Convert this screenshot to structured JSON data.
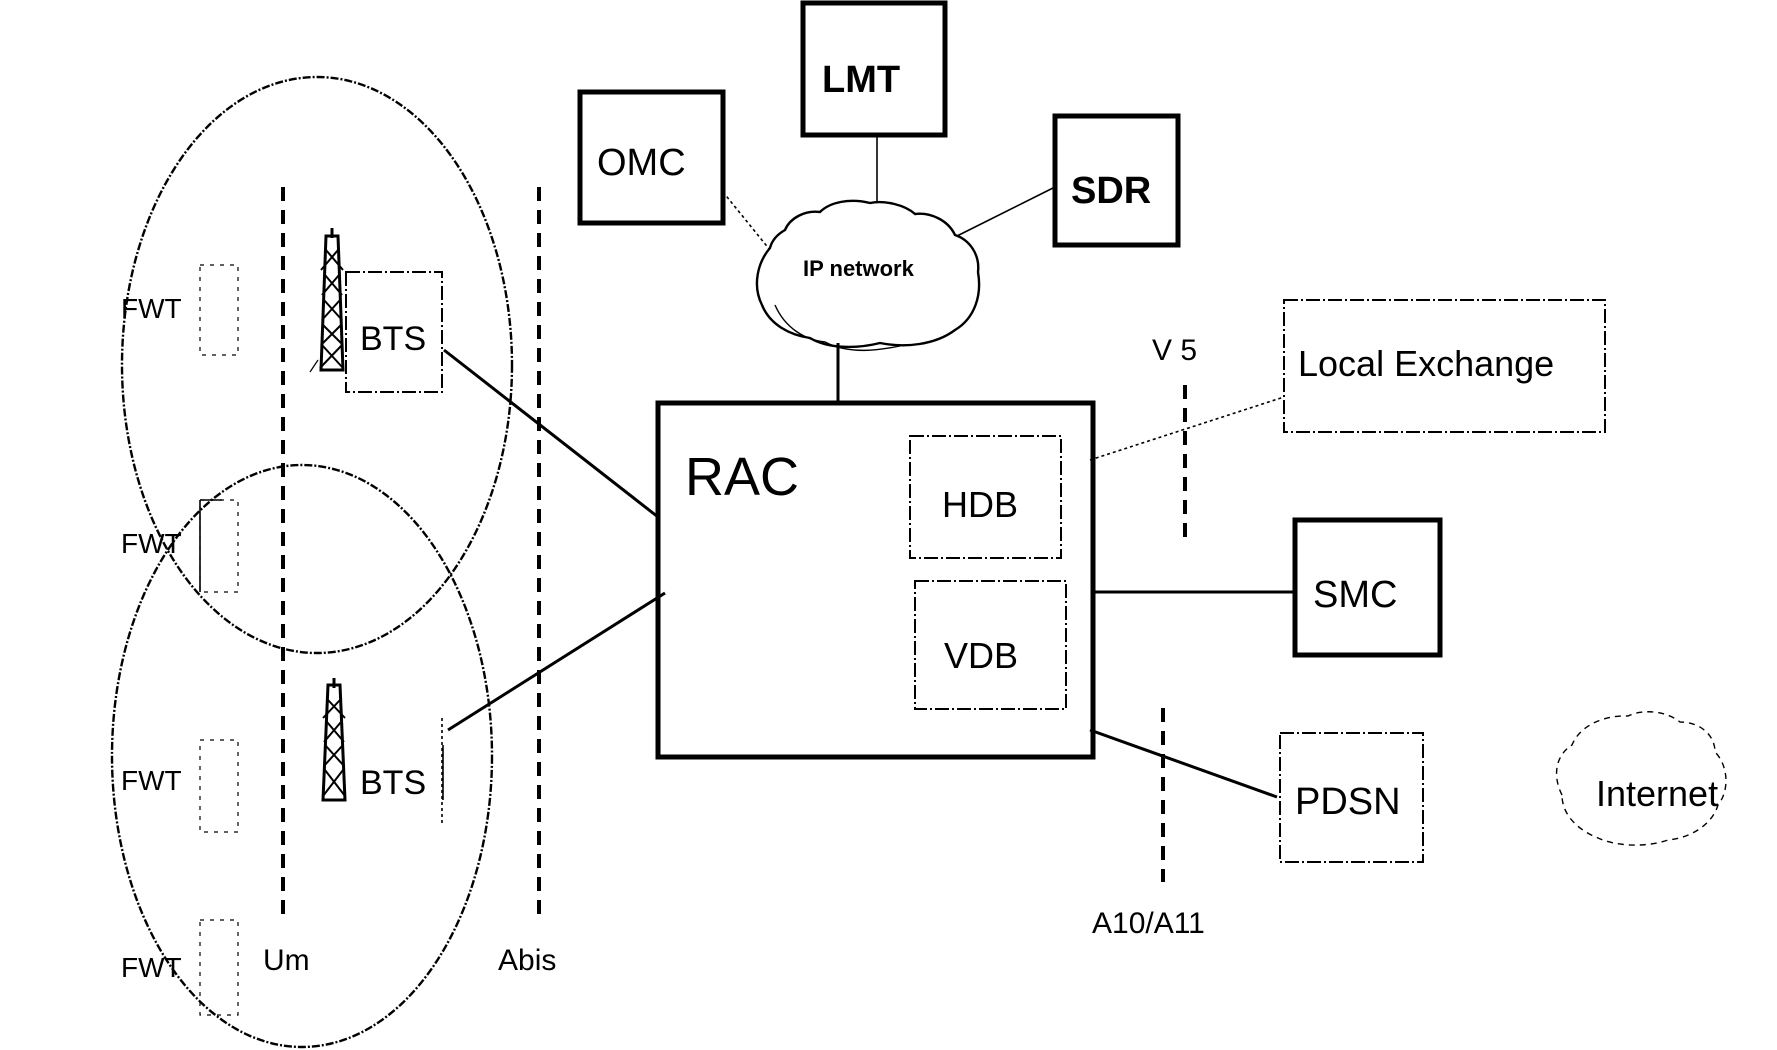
{
  "diagram": {
    "nodes": {
      "omc": "OMC",
      "lmt": "LMT",
      "sdr": "SDR",
      "ip_network": "IP network",
      "local_exchange": "Local Exchange",
      "rac": "RAC",
      "hdb": "HDB",
      "vdb": "VDB",
      "smc": "SMC",
      "pdsn": "PDSN",
      "internet": "Internet",
      "bts_upper": "BTS",
      "bts_lower": "BTS"
    },
    "terminals": [
      "FWT",
      "FWT",
      "FWT",
      "FWT"
    ],
    "interfaces": {
      "um": "Um",
      "abis": "Abis",
      "v5": "V 5",
      "a10_a11": "A10/A11"
    },
    "icons": {
      "bts_tower": "antenna-tower-icon",
      "ip_cloud": "cloud-icon",
      "internet_cloud": "cloud-icon"
    }
  }
}
